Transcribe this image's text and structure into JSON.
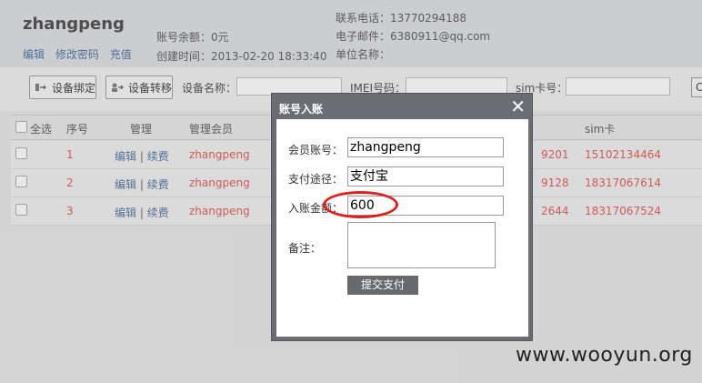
{
  "header": {
    "username": "zhangpeng",
    "links": [
      "编辑",
      "修改密码",
      "充值"
    ],
    "balance": "账号余额：0元",
    "created": "创建时间：2013-02-20 18:33:40",
    "phone": "联系电话：13770294188",
    "email": "电子邮件：6380911@qq.com",
    "company": "单位名称："
  },
  "toolbar": {
    "bind_device": "设备绑定",
    "transfer_device": "设备转移",
    "device_name_label": "设备名称：",
    "imei_label": "IMEI号码：",
    "sim_label": "sim卡号：",
    "cut_button": "C"
  },
  "table": {
    "headers": [
      "全选",
      "序号",
      "管理",
      "管理会员",
      "sim卡"
    ],
    "edit_label": "编辑",
    "renew_label": "续费",
    "separator": "|",
    "rows": [
      {
        "index": "1",
        "member": "zhangpeng",
        "partial": "9201",
        "sim": "15102134464"
      },
      {
        "index": "2",
        "member": "zhangpeng",
        "partial": "9128",
        "sim": "18317067614"
      },
      {
        "index": "3",
        "member": "zhangpeng",
        "partial": "2644",
        "sim": "18317067524"
      }
    ]
  },
  "dialog": {
    "title": "账号入账",
    "close": "✕",
    "account_label": "会员账号：",
    "account_value": "zhangpeng",
    "method_label": "支付途径：",
    "method_value": "支付宝",
    "amount_label": "入账金额：",
    "amount_value": "600",
    "note_label": "备注：",
    "submit": "提交支付"
  },
  "watermark": "www.wooyun.org",
  "colors": {
    "accent_red": "#e05252",
    "link_blue": "#4a6d9c",
    "highlight_circle": "#e02020"
  }
}
